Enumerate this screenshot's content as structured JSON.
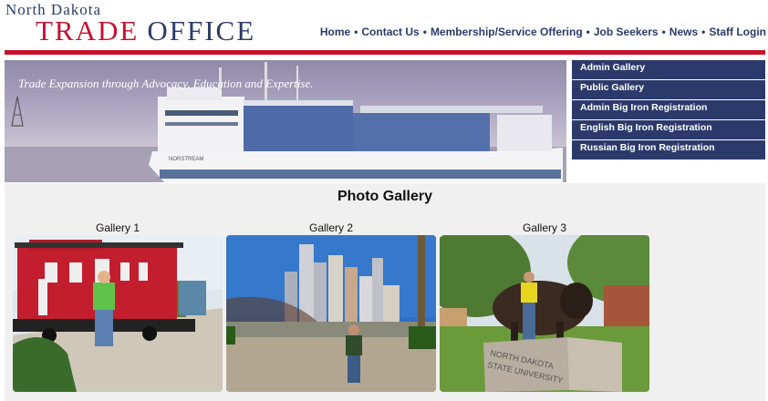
{
  "logo": {
    "line1": "North Dakota",
    "word1": "TRADE",
    "word2": "OFFICE"
  },
  "nav": [
    {
      "label": "Home"
    },
    {
      "label": "Contact Us"
    },
    {
      "label": "Membership/Service Offering"
    },
    {
      "label": "Job Seekers"
    },
    {
      "label": "News"
    },
    {
      "label": "Staff Login"
    }
  ],
  "nav_separator": "•",
  "banner": {
    "tagline": "Trade Expansion through Advocacy, Education and Expertise.",
    "ship_name": "NORSTREAM"
  },
  "sidemenu": [
    {
      "label": "Admin Gallery"
    },
    {
      "label": "Public Gallery"
    },
    {
      "label": "Admin Big Iron Registration"
    },
    {
      "label": "English Big Iron Registration"
    },
    {
      "label": "Russian Big Iron Registration"
    }
  ],
  "gallery": {
    "title": "Photo Gallery",
    "items": [
      {
        "caption": "Gallery 1"
      },
      {
        "caption": "Gallery 2"
      },
      {
        "caption": "Gallery 3",
        "sign_line1": "NORTH DAKOTA",
        "sign_line2": "STATE UNIVERSITY"
      }
    ]
  },
  "colors": {
    "brand_red": "#c8102e",
    "brand_navy": "#2c3a6b",
    "gallery_bg": "#f0f0f0"
  }
}
